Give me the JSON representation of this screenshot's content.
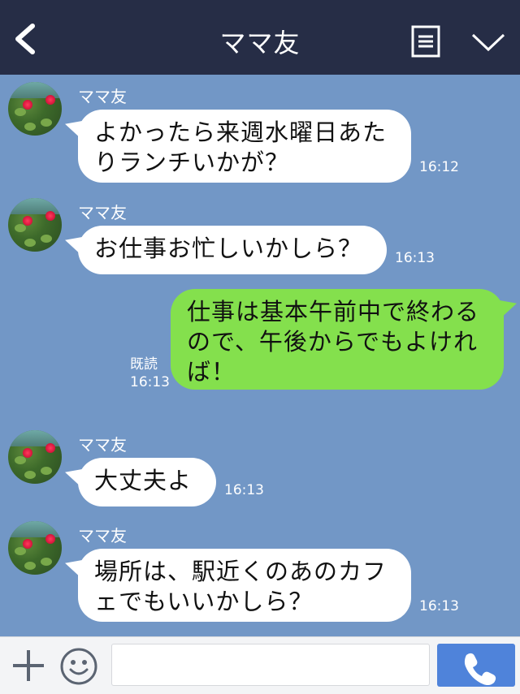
{
  "header": {
    "title": "ママ友",
    "back_icon": "chevron-left-icon",
    "menu_icon": "list-icon",
    "collapse_icon": "chevron-down-icon"
  },
  "messages": [
    {
      "side": "left",
      "sender": "ママ友",
      "lines": [
        "よかったら来週水曜日あた",
        "りランチいかが？"
      ],
      "time": "16:12"
    },
    {
      "side": "left",
      "sender": "ママ友",
      "lines": [
        "お仕事お忙しいかしら？"
      ],
      "time": "16:13"
    },
    {
      "side": "right",
      "lines": [
        "仕事は基本午前中で終わる",
        "ので、午後からでもよけれ",
        "ば！"
      ],
      "read": "既読",
      "time": "16:13"
    },
    {
      "side": "left",
      "sender": "ママ友",
      "lines": [
        "大丈夫よ"
      ],
      "time": "16:13"
    },
    {
      "side": "left",
      "sender": "ママ友",
      "lines": [
        "場所は、駅近くのあのカフ",
        "ェでもいいかしら？"
      ],
      "time": "16:13"
    }
  ],
  "inputbar": {
    "plus_icon": "plus-icon",
    "emoji_icon": "smile-icon",
    "placeholder": "",
    "call_icon": "phone-icon"
  },
  "colors": {
    "header_bg": "#262d46",
    "chat_bg": "#7297c6",
    "my_bubble": "#84e04d",
    "their_bubble": "#ffffff",
    "call_button": "#4f83da"
  }
}
